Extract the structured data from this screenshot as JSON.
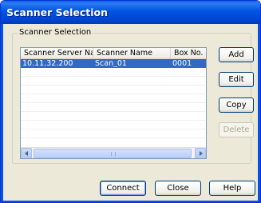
{
  "window": {
    "title": "Scanner Selection"
  },
  "group": {
    "label": "Scanner Selection"
  },
  "list": {
    "columns": [
      "Scanner Server Name",
      "Scanner Name",
      "Box No."
    ],
    "rows": [
      {
        "server": "10.11.32.200",
        "scanner": "Scan_01",
        "box": "0001",
        "selected": true
      }
    ]
  },
  "side_buttons": {
    "add": "Add",
    "edit": "Edit",
    "copy": "Copy",
    "delete": "Delete"
  },
  "bottom_buttons": {
    "connect": "Connect",
    "close": "Close",
    "help": "Help"
  },
  "colors": {
    "title_bar": "#0054e3",
    "selection": "#316ac5",
    "dialog_bg": "#ece9d8"
  },
  "icons": {
    "scroll_left": "chevron-left-icon",
    "scroll_right": "chevron-right-icon"
  }
}
